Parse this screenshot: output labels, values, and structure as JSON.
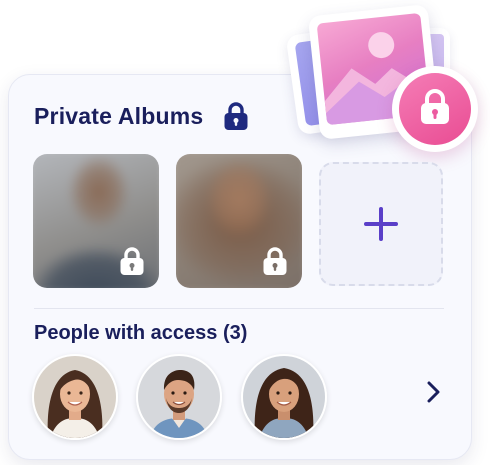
{
  "private_albums": {
    "title": "Private Albums",
    "title_icon": "lock-icon",
    "albums": [
      {
        "icon": "lock-icon"
      },
      {
        "icon": "lock-icon"
      }
    ],
    "add_icon": "plus-icon"
  },
  "people": {
    "title": "People with access (3)",
    "avatars": [
      "avatar",
      "avatar",
      "avatar"
    ],
    "next_icon": "chevron-right-icon"
  },
  "colors": {
    "heading": "#1a1f5c",
    "accent_purple": "#5a3fc8",
    "badge_pink": "#e94c93",
    "card_bg": "#f8f9fe"
  }
}
